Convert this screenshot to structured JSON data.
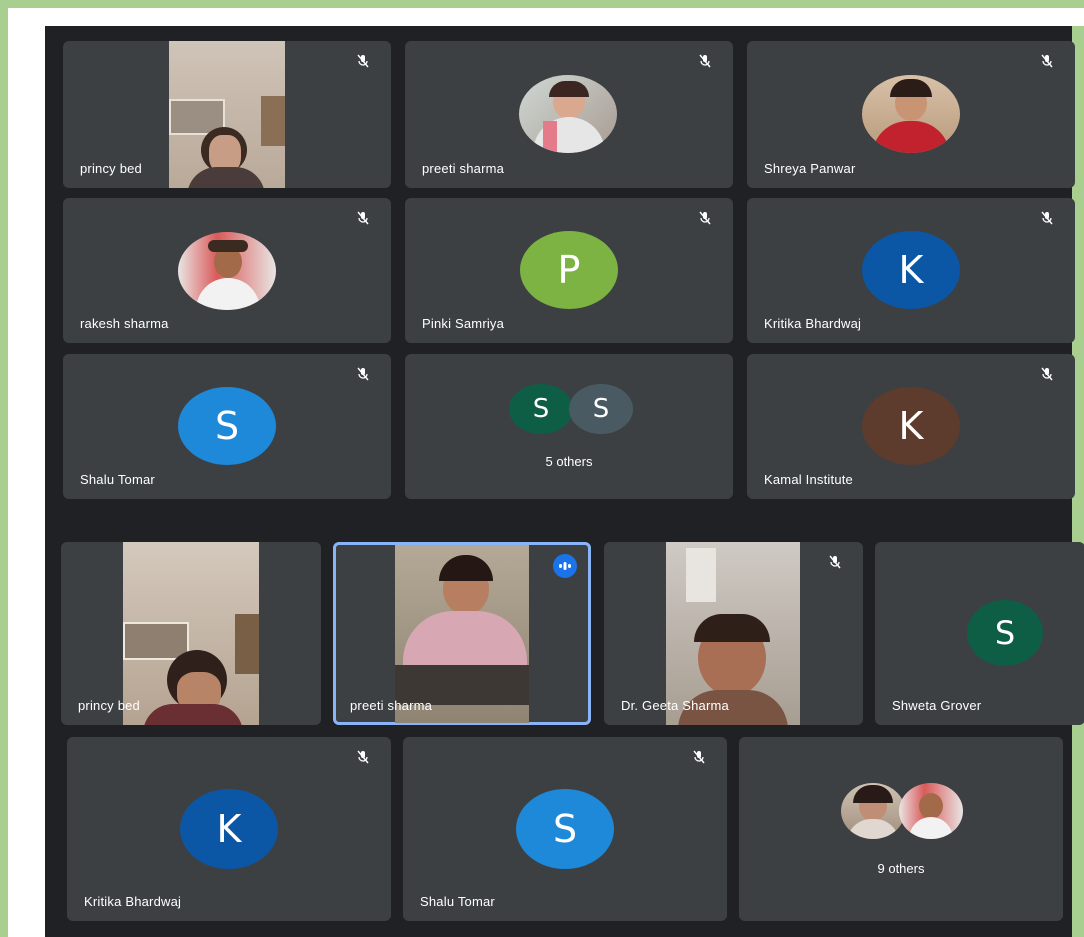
{
  "top_grid": {
    "tiles": [
      {
        "name": "princy bed",
        "muted": true,
        "kind": "video"
      },
      {
        "name": "preeti sharma",
        "muted": true,
        "kind": "photo"
      },
      {
        "name": "Shreya Panwar",
        "muted": true,
        "kind": "photo"
      },
      {
        "name": "rakesh sharma",
        "muted": true,
        "kind": "photo"
      },
      {
        "name": "Pinki Samriya",
        "muted": true,
        "kind": "letter",
        "letter": "P",
        "color": "#7cb342"
      },
      {
        "name": "Kritika Bhardwaj",
        "muted": true,
        "kind": "letter",
        "letter": "K",
        "color": "#0b57a5"
      },
      {
        "name": "Shalu Tomar",
        "muted": true,
        "kind": "letter",
        "letter": "S",
        "color": "#1e88d9"
      },
      {
        "kind": "others",
        "letters": [
          "S",
          "S"
        ],
        "colors": [
          "#0d5e45",
          "#4a5a63"
        ],
        "label": "5 others"
      },
      {
        "name": "Kamal Institute",
        "muted": true,
        "kind": "letter",
        "letter": "K",
        "color": "#5d3b2d"
      }
    ]
  },
  "bottom_grid": {
    "tiles": [
      {
        "name": "princy bed",
        "kind": "video"
      },
      {
        "name": "preeti sharma",
        "kind": "video",
        "speaking": true
      },
      {
        "name": "Dr. Geeta Sharma",
        "muted": true,
        "kind": "video"
      },
      {
        "name": "Shweta Grover",
        "kind": "letter",
        "letter": "S",
        "color": "#0d5e45"
      },
      {
        "name": "Kritika Bhardwaj",
        "muted": true,
        "kind": "letter",
        "letter": "K",
        "color": "#0b57a5"
      },
      {
        "name": "Shalu Tomar",
        "muted": true,
        "kind": "letter",
        "letter": "S",
        "color": "#1e88d9"
      },
      {
        "kind": "others",
        "label": "9 others"
      }
    ]
  },
  "icons": {
    "mute": "mic-off-icon",
    "speaking": "audio-level-icon"
  }
}
